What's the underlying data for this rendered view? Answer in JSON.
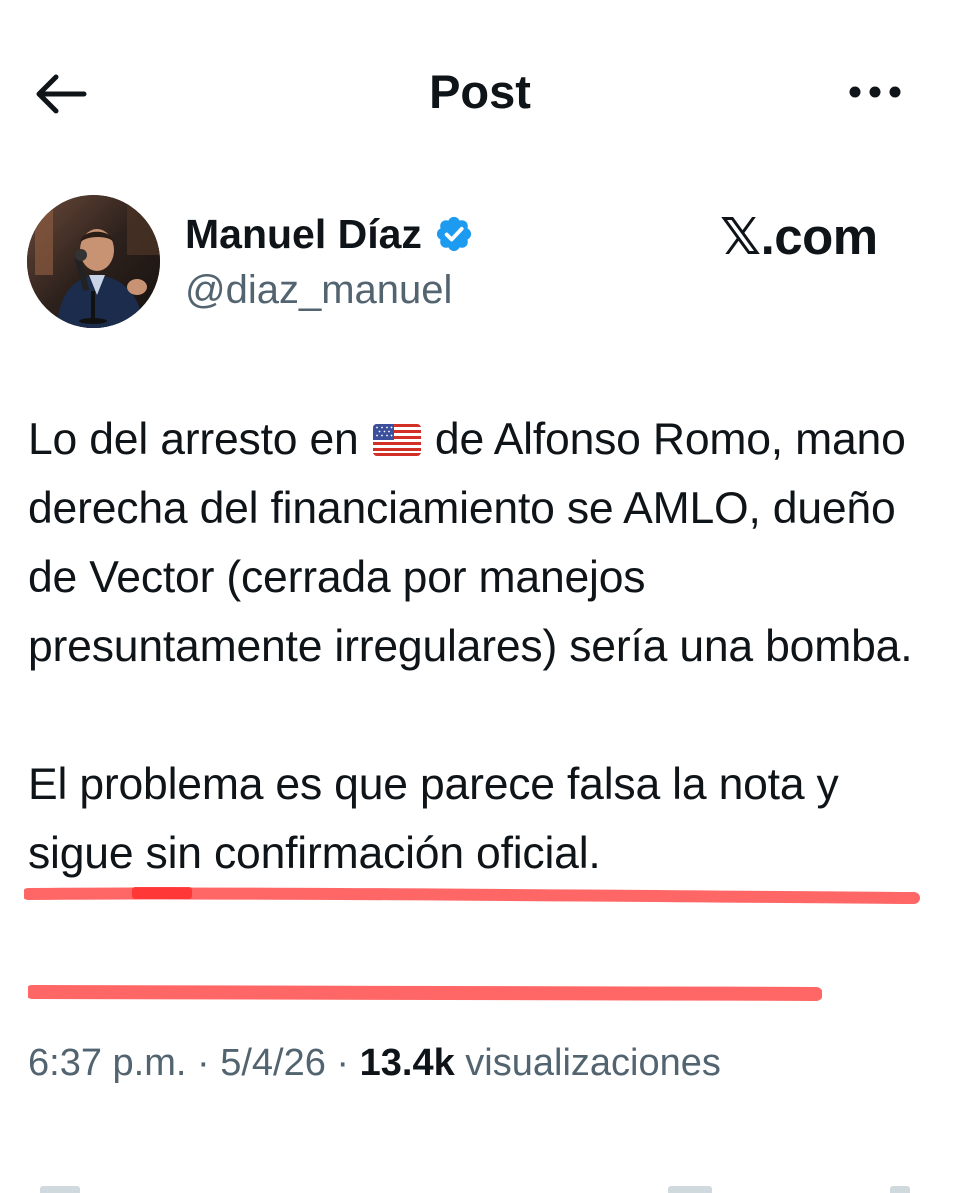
{
  "header": {
    "title": "Post",
    "back_icon": "arrow-left-icon",
    "more_icon": "more-horizontal-icon"
  },
  "author": {
    "name": "Manuel Díaz",
    "handle": "@diaz_manuel",
    "verified_icon": "verified-badge-icon",
    "verified_color": "#1d9bf0"
  },
  "watermark": "𝕏.com",
  "post": {
    "text_before_flag": "Lo del arresto en ",
    "flag_icon": "us-flag-icon",
    "text_after_flag": " de Alfonso Romo, mano derecha del financiamiento se AMLO, dueño de Vector (cerrada por manejos presuntamente irregulares) sería una bomba.",
    "paragraph2": "El problema es que parece falsa la nota y sigue sin confirmación oficial.",
    "highlight_color": "#ff5a5a"
  },
  "meta": {
    "time": "6:37 p.m.",
    "separator": " · ",
    "date": "5/4/26",
    "views_count": "13.4k",
    "views_label": " visualizaciones"
  }
}
